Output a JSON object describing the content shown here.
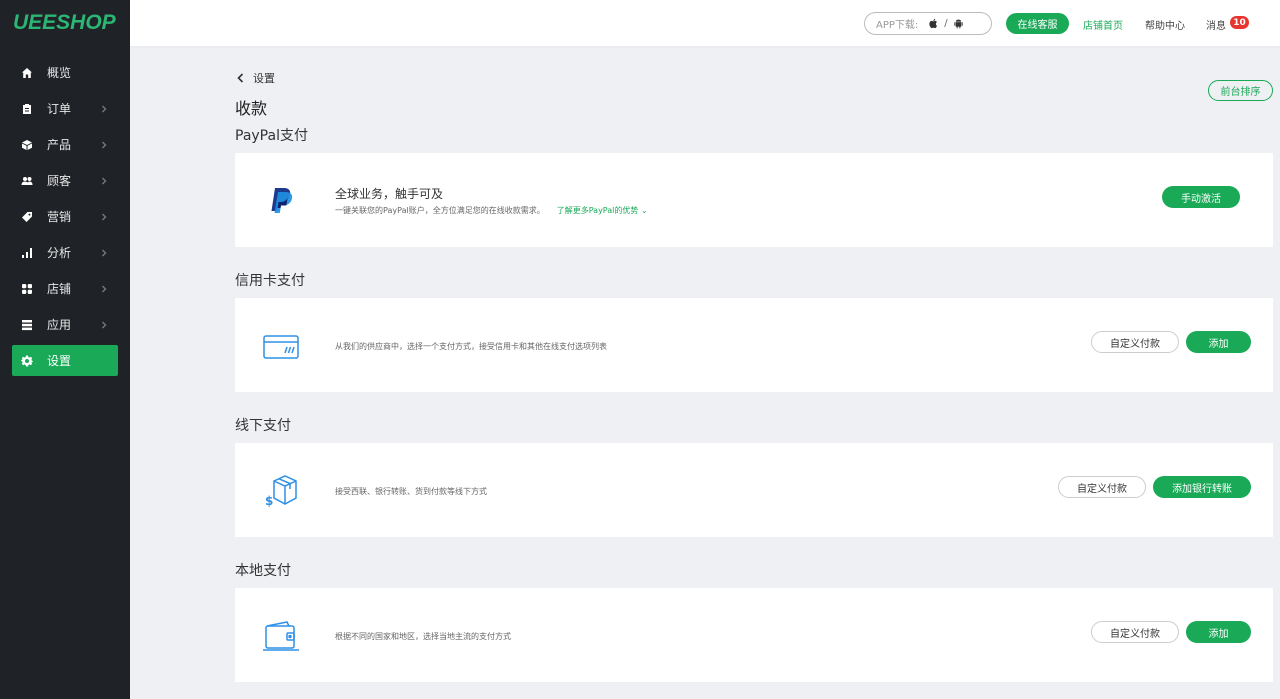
{
  "brand": {
    "logo": "UEESHOP",
    "accent": "#19a957",
    "sidebar_bg": "#1f2227"
  },
  "sidebar": {
    "items": [
      {
        "label": "概览",
        "icon": "home-icon",
        "chevron": false
      },
      {
        "label": "订单",
        "icon": "clipboard-icon",
        "chevron": true
      },
      {
        "label": "产品",
        "icon": "box-icon",
        "chevron": true
      },
      {
        "label": "顾客",
        "icon": "users-icon",
        "chevron": true
      },
      {
        "label": "营销",
        "icon": "tag-icon",
        "chevron": true
      },
      {
        "label": "分析",
        "icon": "bar-chart-icon",
        "chevron": true
      },
      {
        "label": "店铺",
        "icon": "grid-icon",
        "chevron": true
      },
      {
        "label": "应用",
        "icon": "stack-icon",
        "chevron": true
      },
      {
        "label": "设置",
        "icon": "gear-icon",
        "chevron": false,
        "active": true
      }
    ]
  },
  "topbar": {
    "app_download": "APP下载:",
    "app_sep": "/",
    "service": "在线客服",
    "store_home": "店铺首页",
    "help": "帮助中心",
    "messages": "消息",
    "message_count": "10"
  },
  "page": {
    "breadcrumb": "设置",
    "title": "收款",
    "front_sort": "前台排序"
  },
  "sections": {
    "paypal": {
      "title": "PayPal支付",
      "headline": "全球业务，触手可及",
      "desc": "一键关联您的PayPal账户，全方位满足您的在线收款需求。",
      "more": "了解更多PayPal的优势",
      "button": "手动激活"
    },
    "card": {
      "title": "信用卡支付",
      "desc": "从我们的供应商中，选择一个支付方式，接受信用卡和其他在线支付选项列表",
      "custom": "自定义付款",
      "add": "添加"
    },
    "offline": {
      "title": "线下支付",
      "desc": "接受西联、银行转账、货到付款等线下方式",
      "custom": "自定义付款",
      "add": "添加银行转账"
    },
    "local": {
      "title": "本地支付",
      "desc": "根据不同的国家和地区，选择当地主流的支付方式",
      "custom": "自定义付款",
      "add": "添加"
    }
  }
}
